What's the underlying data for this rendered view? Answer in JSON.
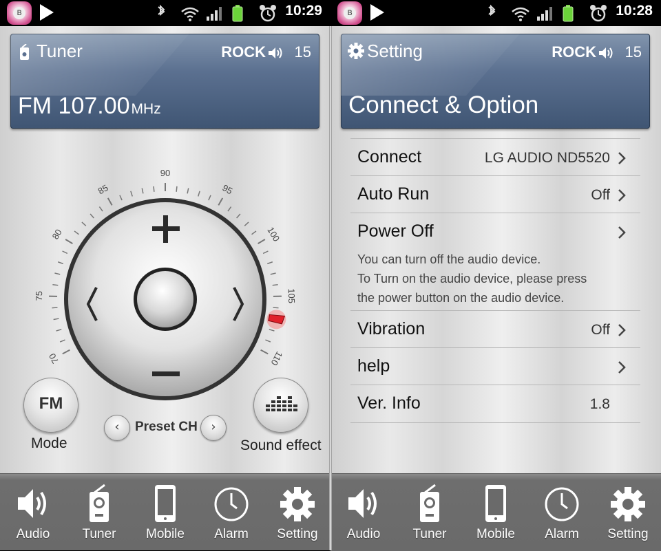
{
  "status_bar_left": {
    "time": "10:29"
  },
  "status_bar_right": {
    "time": "10:28"
  },
  "tuner_screen": {
    "header": {
      "title": "Tuner",
      "genre": "ROCK",
      "volume": "15",
      "band": "FM",
      "frequency": "107.00",
      "unit": "MHz"
    },
    "dial": {
      "ticks": [
        "70",
        "75",
        "80",
        "85",
        "90",
        "95",
        "100",
        "105",
        "110"
      ],
      "needle_value_mhz": 107.0
    },
    "mode_button": {
      "label": "FM",
      "caption": "Mode"
    },
    "preset": {
      "label": "Preset CH"
    },
    "sound_effect": {
      "caption": "Sound effect"
    }
  },
  "setting_screen": {
    "header": {
      "title": "Setting",
      "genre": "ROCK",
      "volume": "15",
      "heading": "Connect & Option"
    },
    "rows": [
      {
        "label": "Connect",
        "value": "LG AUDIO ND5520"
      },
      {
        "label": "Auto Run",
        "value": "Off"
      },
      {
        "label": "Power Off",
        "value": ""
      },
      {
        "label": "Vibration",
        "value": "Off"
      },
      {
        "label": "help",
        "value": ""
      },
      {
        "label": "Ver. Info",
        "value": "1.8"
      }
    ],
    "power_off_description": [
      "You can turn off the audio device.",
      "To Turn on the audio device, please press",
      "the power button on the audio device."
    ]
  },
  "nav": {
    "items": [
      "Audio",
      "Tuner",
      "Mobile",
      "Alarm",
      "Setting"
    ]
  },
  "colors": {
    "header_blue": "#5b7090",
    "needle_red": "#e0202a",
    "nav_gray": "#6e6e6e"
  }
}
